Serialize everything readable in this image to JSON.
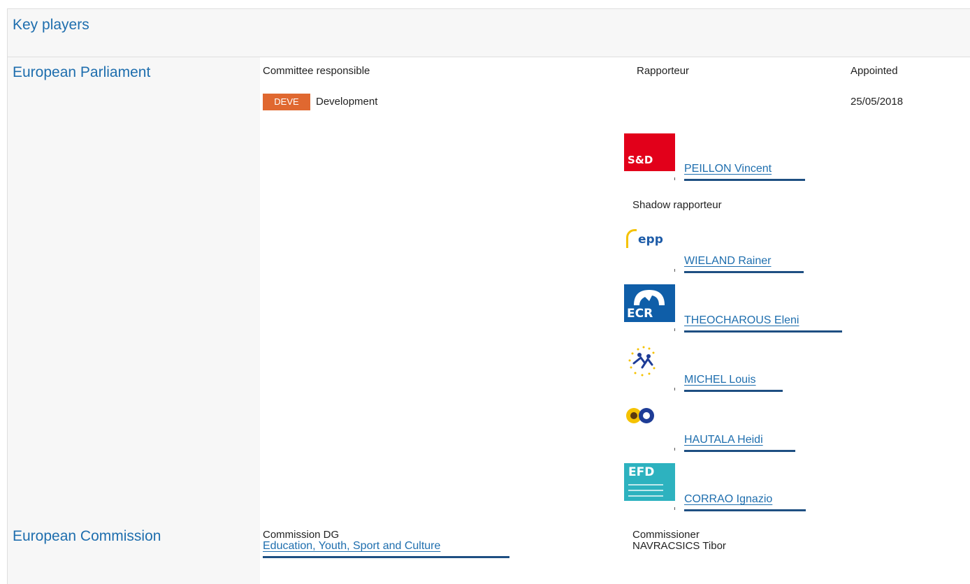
{
  "section": {
    "title": "Key players"
  },
  "parliament": {
    "name": "European Parliament",
    "committee_header": "Committee responsible",
    "rapporteur_header": "Rapporteur",
    "appointed_header": "Appointed",
    "committee": {
      "code": "DEVE",
      "name": "Development",
      "appointed": "25/05/2018"
    },
    "rapporteur": {
      "name": "PEILLON Vincent",
      "group_logo_text": "S&D",
      "group_logo_icon": "sd-group-logo"
    },
    "shadow_header": "Shadow rapporteur",
    "shadows": [
      {
        "name": "WIELAND Rainer",
        "group_logo_text": "epp",
        "group_logo_icon": "epp-group-logo"
      },
      {
        "name": "THEOCHAROUS Eleni",
        "group_logo_text": "ECR",
        "group_logo_icon": "ecr-group-logo"
      },
      {
        "name": "MICHEL Louis",
        "group_logo_text": "",
        "group_logo_icon": "alde-group-logo"
      },
      {
        "name": "HAUTALA Heidi",
        "group_logo_text": "",
        "group_logo_icon": "greens-efa-group-logo"
      },
      {
        "name": "CORRAO Ignazio",
        "group_logo_text": "EFD",
        "group_logo_icon": "efdd-group-logo"
      }
    ]
  },
  "commission": {
    "name": "European Commission",
    "dg_header": "Commission DG",
    "commissioner_header": "Commissioner",
    "dg": "Education, Youth, Sport and Culture",
    "commissioner": "NAVRACSICS Tibor"
  },
  "colors": {
    "link": "#1e6eae",
    "badge": "#e06830",
    "header_bg": "#f7f7f7",
    "underline_bar": "#1e4f82"
  }
}
